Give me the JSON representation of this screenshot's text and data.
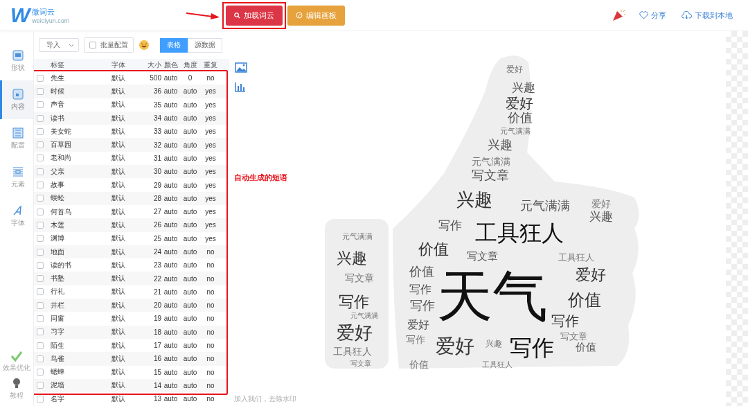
{
  "header": {
    "logo": {
      "mark": "W",
      "name": "微词云",
      "domain": "weiciyun.com"
    },
    "buttons": [
      {
        "label": "加载词云",
        "kind": "load",
        "highlighted": true
      },
      {
        "label": "编辑画板",
        "kind": "edit",
        "highlighted": false
      }
    ],
    "links": [
      {
        "label": "分享",
        "kind": "share"
      },
      {
        "label": "下载到本地",
        "kind": "download"
      }
    ]
  },
  "sidebar": {
    "items": [
      {
        "label": "形状",
        "kind": "shape",
        "selected": false
      },
      {
        "label": "内容",
        "kind": "content",
        "selected": true
      },
      {
        "label": "配置",
        "kind": "config",
        "selected": false
      },
      {
        "label": "元素",
        "kind": "element",
        "selected": false
      },
      {
        "label": "字体",
        "kind": "font",
        "selected": false
      }
    ],
    "bottom": [
      {
        "label": "效果优化",
        "kind": "check"
      },
      {
        "label": "教程",
        "kind": "bulb"
      }
    ]
  },
  "toolbar": {
    "import": "导入",
    "batch": {
      "label": "批量配置",
      "checked": false
    },
    "views": [
      {
        "label": "表格",
        "selected": true
      },
      {
        "label": "源数据",
        "selected": false
      }
    ]
  },
  "table": {
    "columns": [
      "标签",
      "字体",
      "大小",
      "颜色",
      "角度",
      "重复"
    ],
    "rows": [
      {
        "label": "先生",
        "font": "默认",
        "size": "500",
        "color_mode": "auto",
        "angle": "0",
        "repeat": "no",
        "checked": false
      },
      {
        "label": "时候",
        "font": "默认",
        "size": "36",
        "color_mode": "auto",
        "angle": "auto",
        "repeat": "yes",
        "checked": false
      },
      {
        "label": "声音",
        "font": "默认",
        "size": "35",
        "color_mode": "auto",
        "angle": "auto",
        "repeat": "yes",
        "checked": false
      },
      {
        "label": "读书",
        "font": "默认",
        "size": "34",
        "color_mode": "auto",
        "angle": "auto",
        "repeat": "yes",
        "checked": false
      },
      {
        "label": "美女蛇",
        "font": "默认",
        "size": "33",
        "color_mode": "auto",
        "angle": "auto",
        "repeat": "yes",
        "checked": false
      },
      {
        "label": "百草园",
        "font": "默认",
        "size": "32",
        "color_mode": "auto",
        "angle": "auto",
        "repeat": "yes",
        "checked": false
      },
      {
        "label": "老和尚",
        "font": "默认",
        "size": "31",
        "color_mode": "auto",
        "angle": "auto",
        "repeat": "yes",
        "checked": false
      },
      {
        "label": "父亲",
        "font": "默认",
        "size": "30",
        "color_mode": "auto",
        "angle": "auto",
        "repeat": "yes",
        "checked": false
      },
      {
        "label": "故事",
        "font": "默认",
        "size": "29",
        "color_mode": "auto",
        "angle": "auto",
        "repeat": "yes",
        "checked": false
      },
      {
        "label": "蜈蚣",
        "font": "默认",
        "size": "28",
        "color_mode": "auto",
        "angle": "auto",
        "repeat": "yes",
        "checked": false
      },
      {
        "label": "何首乌",
        "font": "默认",
        "size": "27",
        "color_mode": "auto",
        "angle": "auto",
        "repeat": "yes",
        "checked": false
      },
      {
        "label": "木莲",
        "font": "默认",
        "size": "26",
        "color_mode": "auto",
        "angle": "auto",
        "repeat": "yes",
        "checked": false
      },
      {
        "label": "渊博",
        "font": "默认",
        "size": "25",
        "color_mode": "auto",
        "angle": "auto",
        "repeat": "yes",
        "checked": false
      },
      {
        "label": "地面",
        "font": "默认",
        "size": "24",
        "color_mode": "auto",
        "angle": "auto",
        "repeat": "no",
        "checked": false
      },
      {
        "label": "读的书",
        "font": "默认",
        "size": "23",
        "color_mode": "auto",
        "angle": "auto",
        "repeat": "no",
        "checked": false
      },
      {
        "label": "书塾",
        "font": "默认",
        "size": "22",
        "color_mode": "auto",
        "angle": "auto",
        "repeat": "no",
        "checked": false
      },
      {
        "label": "行礼",
        "font": "默认",
        "size": "21",
        "color_mode": "auto",
        "angle": "auto",
        "repeat": "no",
        "checked": false
      },
      {
        "label": "井栏",
        "font": "默认",
        "size": "20",
        "color_mode": "auto",
        "angle": "auto",
        "repeat": "no",
        "checked": false
      },
      {
        "label": "同窗",
        "font": "默认",
        "size": "19",
        "color_mode": "auto",
        "angle": "auto",
        "repeat": "no",
        "checked": false
      },
      {
        "label": "习字",
        "font": "默认",
        "size": "18",
        "color_mode": "auto",
        "angle": "auto",
        "repeat": "no",
        "checked": false
      },
      {
        "label": "陌生",
        "font": "默认",
        "size": "17",
        "color_mode": "auto",
        "angle": "auto",
        "repeat": "no",
        "checked": false
      },
      {
        "label": "鸟雀",
        "font": "默认",
        "size": "16",
        "color_mode": "auto",
        "angle": "auto",
        "repeat": "no",
        "checked": false
      },
      {
        "label": "蟋蟀",
        "font": "默认",
        "size": "15",
        "color_mode": "auto",
        "angle": "auto",
        "repeat": "no",
        "checked": false
      },
      {
        "label": "泥墙",
        "font": "默认",
        "size": "14",
        "color_mode": "auto",
        "angle": "auto",
        "repeat": "no",
        "checked": false
      },
      {
        "label": "名字",
        "font": "默认",
        "size": "13",
        "color_mode": "auto",
        "angle": "auto",
        "repeat": "no",
        "checked": false
      }
    ]
  },
  "annotation": "自动生成的短语",
  "word_cloud": {
    "pinky_words": [
      "元气满满",
      "兴趣",
      "写文章",
      "写作",
      "元气满满",
      "爱好",
      "工具狂人",
      "写文章"
    ],
    "hand_words": [
      "爱好",
      "兴趣",
      "爱好",
      "价值",
      "元气满满",
      "兴趣",
      "元气满满",
      "写文章",
      "兴趣",
      "元气满满",
      "爱好",
      "兴趣",
      "写作",
      "工具狂人",
      "价值",
      "写文章",
      "工具狂人",
      "价值",
      "天气",
      "爱好",
      "写作",
      "写作",
      "价值",
      "爱好",
      "写作",
      "写作",
      "爱好",
      "兴趣",
      "写作",
      "写文章",
      "价值",
      "价值",
      "工具狂人"
    ]
  },
  "footer": "加入我们，去除水印"
}
